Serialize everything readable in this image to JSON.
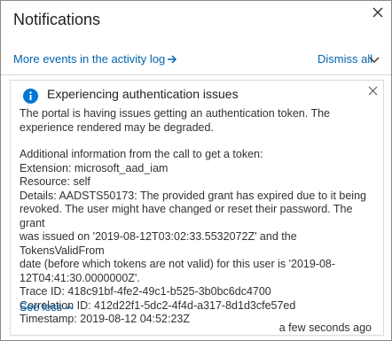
{
  "header": {
    "title": "Notifications"
  },
  "toolbar": {
    "activity_log_link": "More events in the activity log",
    "dismiss_all": "Dismiss all"
  },
  "notification": {
    "title": "Experiencing authentication issues",
    "summary_line1": "The portal is having issues getting an authentication token. The",
    "summary_line2": "experience rendered may be degraded.",
    "additional_info": "Additional information from the call to get a token:",
    "extension": "Extension: microsoft_aad_iam",
    "resource": "Resource: self",
    "details_line1": "Details: AADSTS50173: The provided grant has expired due to it being",
    "details_line2": "revoked. The user might have changed or reset their password. The grant",
    "details_line3": "was issued on '2019-08-12T03:02:33.5532072Z' and the TokensValidFrom",
    "details_line4": "date (before which tokens are not valid) for this user is '2019-08-",
    "details_line5": "12T04:41:30.0000000Z'.",
    "trace_id": "Trace ID: 418c91bf-4fe2-49c1-b525-3b0bc6dc4700",
    "correlation_id": "Correlation ID: 412d22f1-5dc2-4f4d-a317-8d1d3cfe57ed",
    "timestamp": "Timestamp: 2019-08-12 04:52:23Z",
    "see_less": "See less",
    "time_ago": "a few seconds ago"
  },
  "colors": {
    "link": "#0062ad",
    "info_icon": "#0078d4"
  },
  "icons": {
    "close": "close-icon",
    "arrow": "arrow-right-icon",
    "chevron": "chevron-down-icon",
    "info": "info-icon",
    "chevron_up": "chevron-up-icon"
  }
}
